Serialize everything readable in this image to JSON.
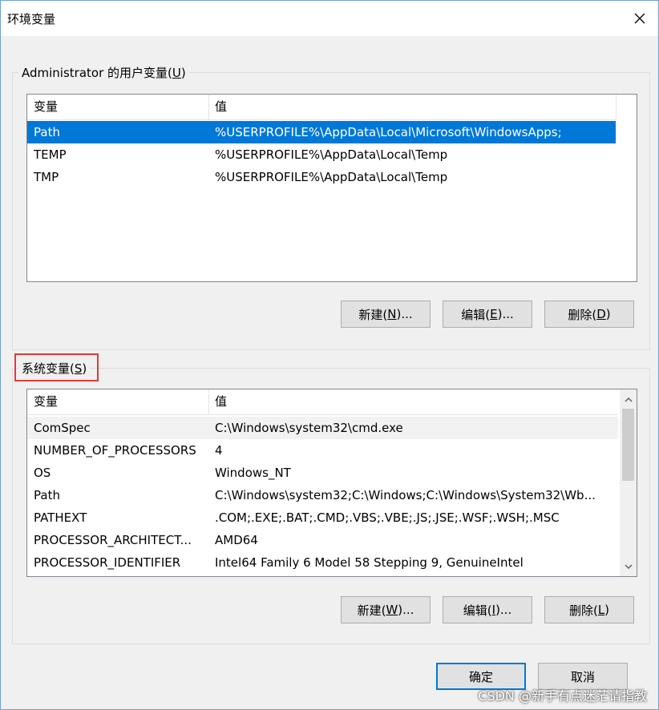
{
  "window": {
    "title": "环境变量"
  },
  "user_vars": {
    "label_prefix": "Administrator 的用户变量(",
    "label_hotkey": "U",
    "label_suffix": ")",
    "columns": [
      "变量",
      "值"
    ],
    "rows": [
      {
        "name": "Path",
        "value": "%USERPROFILE%\\AppData\\Local\\Microsoft\\WindowsApps;"
      },
      {
        "name": "TEMP",
        "value": "%USERPROFILE%\\AppData\\Local\\Temp"
      },
      {
        "name": "TMP",
        "value": "%USERPROFILE%\\AppData\\Local\\Temp"
      }
    ],
    "buttons": {
      "new": {
        "prefix": "新建(",
        "hotkey": "N",
        "suffix": ")..."
      },
      "edit": {
        "prefix": "编辑(",
        "hotkey": "E",
        "suffix": ")..."
      },
      "delete": {
        "prefix": "删除(",
        "hotkey": "D",
        "suffix": ")"
      }
    }
  },
  "system_vars": {
    "label_prefix": "系统变量(",
    "label_hotkey": "S",
    "label_suffix": ")",
    "columns": [
      "变量",
      "值"
    ],
    "rows": [
      {
        "name": "ComSpec",
        "value": "C:\\Windows\\system32\\cmd.exe"
      },
      {
        "name": "NUMBER_OF_PROCESSORS",
        "value": "4"
      },
      {
        "name": "OS",
        "value": "Windows_NT"
      },
      {
        "name": "Path",
        "value": "C:\\Windows\\system32;C:\\Windows;C:\\Windows\\System32\\Wb..."
      },
      {
        "name": "PATHEXT",
        "value": ".COM;.EXE;.BAT;.CMD;.VBS;.VBE;.JS;.JSE;.WSF;.WSH;.MSC"
      },
      {
        "name": "PROCESSOR_ARCHITECT...",
        "value": "AMD64"
      },
      {
        "name": "PROCESSOR_IDENTIFIER",
        "value": "Intel64 Family 6 Model 58 Stepping 9, GenuineIntel"
      }
    ],
    "buttons": {
      "new": {
        "prefix": "新建(",
        "hotkey": "W",
        "suffix": ")..."
      },
      "edit": {
        "prefix": "编辑(",
        "hotkey": "I",
        "suffix": ")..."
      },
      "delete": {
        "prefix": "删除(",
        "hotkey": "L",
        "suffix": ")"
      }
    }
  },
  "dialog_buttons": {
    "ok": "确定",
    "cancel": "取消"
  },
  "watermark": "CSDN @新手有点迷茫请指教",
  "colors": {
    "selection": "#0078d7",
    "highlight_box": "#e53935",
    "window_border": "#6fa0d8"
  }
}
